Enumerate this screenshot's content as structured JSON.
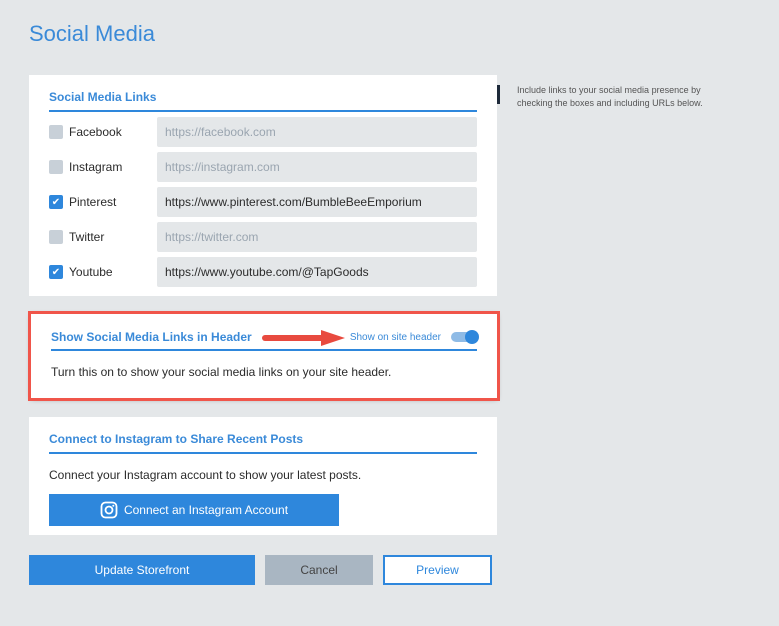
{
  "page_title": "Social Media",
  "links": {
    "heading": "Social Media Links",
    "items": [
      {
        "label": "Facebook",
        "checked": false,
        "value": "",
        "placeholder": "https://facebook.com"
      },
      {
        "label": "Instagram",
        "checked": false,
        "value": "",
        "placeholder": "https://instagram.com"
      },
      {
        "label": "Pinterest",
        "checked": true,
        "value": "https://www.pinterest.com/BumbleBeeEmporium",
        "placeholder": ""
      },
      {
        "label": "Twitter",
        "checked": false,
        "value": "",
        "placeholder": "https://twitter.com"
      },
      {
        "label": "Youtube",
        "checked": true,
        "value": "https://www.youtube.com/@TapGoods",
        "placeholder": ""
      }
    ]
  },
  "side_help": "Include links to your social media presence by checking the boxes and including URLs below.",
  "header_section": {
    "heading": "Show Social Media Links in Header",
    "toggle_label": "Show on site header",
    "toggle_on": true,
    "description": "Turn this on to show your social media links on your site header.",
    "highlight_color": "#f0554a"
  },
  "instagram": {
    "heading": "Connect to Instagram to Share Recent Posts",
    "description": "Connect your Instagram account to show your latest posts.",
    "button": "Connect an Instagram Account"
  },
  "actions": {
    "update": "Update Storefront",
    "cancel": "Cancel",
    "preview": "Preview"
  },
  "accent": "#2e87dc"
}
